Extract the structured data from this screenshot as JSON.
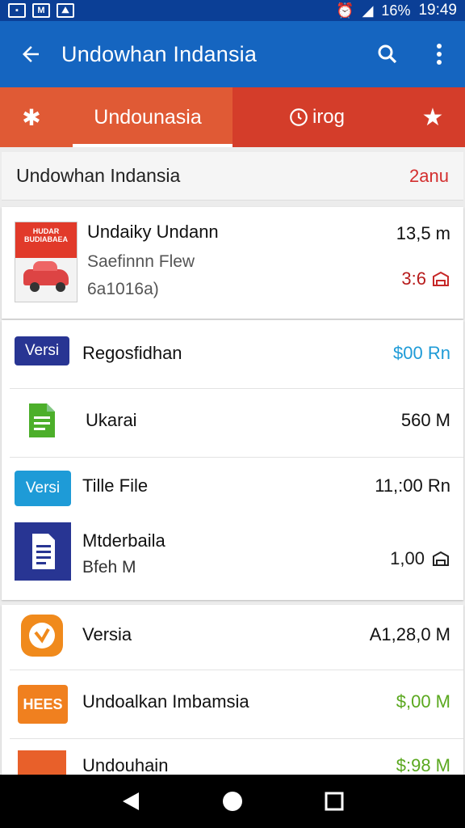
{
  "status_bar": {
    "time": "19:49",
    "battery": "16%",
    "left_icons": [
      "photo-icon",
      "gmail-icon",
      "image-icon"
    ],
    "right_icons": [
      "alarm-icon",
      "signal-icon",
      "wifi-icon"
    ]
  },
  "app_bar": {
    "title": "Undowhan Indansia",
    "icons": [
      "back-arrow-icon",
      "search-icon",
      "more-vert-icon"
    ]
  },
  "tabs": [
    {
      "icon": "home-asterisk-icon"
    },
    {
      "label": "Undounasia",
      "selected": true
    },
    {
      "label": "irog",
      "icon": "clock-icon"
    },
    {
      "icon": "star-icon"
    }
  ],
  "header": {
    "title": "Undowhan Indansia",
    "badge": "2anu"
  },
  "card1": {
    "thumb_text": "HUDAR\nBUDIABAEA",
    "title": "Undaiky Undann",
    "subtitle": "Saefinnn Flew",
    "meta": "6a1016a)",
    "size": "13,5 m",
    "count": "3:6"
  },
  "card2": {
    "rows": [
      {
        "badge": "Versi",
        "label": "Regosfidhan",
        "value": "$00 Rn"
      },
      {
        "label": "Ukarai",
        "value": "560 M"
      },
      {
        "badge": "Versi",
        "label": "Tille File",
        "value": "11,:00 Rn"
      },
      {
        "label": "Mtderbaila",
        "sub": "Bfeh M",
        "value": "1,00"
      }
    ]
  },
  "card3": {
    "rows": [
      {
        "label": "Versia",
        "value": "A1,28,0 M"
      },
      {
        "badge": "HEES",
        "label": "Undoalkan Imbamsia",
        "value": "$,00 M"
      },
      {
        "label": "Undouhain",
        "value": "$:98 M"
      }
    ]
  },
  "colors": {
    "appbar": "#1565c0",
    "statusbar": "#0b3f96",
    "tab_primary": "#e05a35",
    "tab_secondary": "#d43d2a",
    "value_blue": "#1e9bd7",
    "value_green": "#5aa81e",
    "badge_red": "#d32f2f"
  }
}
